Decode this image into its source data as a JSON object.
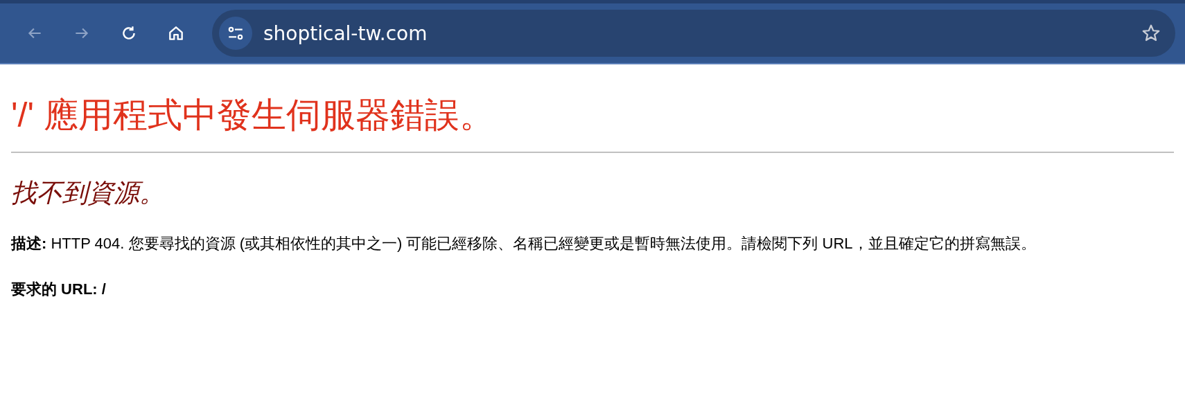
{
  "toolbar": {
    "nav_buttons": [
      {
        "kind": "back",
        "disabled": true
      },
      {
        "kind": "forward",
        "disabled": true
      },
      {
        "kind": "reload",
        "disabled": false
      },
      {
        "kind": "home",
        "disabled": false
      }
    ],
    "address": "shoptical-tw.com"
  },
  "page": {
    "title": "'/' 應用程式中發生伺服器錯誤。",
    "subtitle": "找不到資源。",
    "description": "**描述:** HTTP 404. 您要尋找的資源 (或其相依性的其中之一) 可能已經移除、名稱已經變更或是暫時無法使用。請檢閱下列 URL，並且確定它的拼寫無誤。",
    "requested_url": "要求的 URL: /"
  }
}
